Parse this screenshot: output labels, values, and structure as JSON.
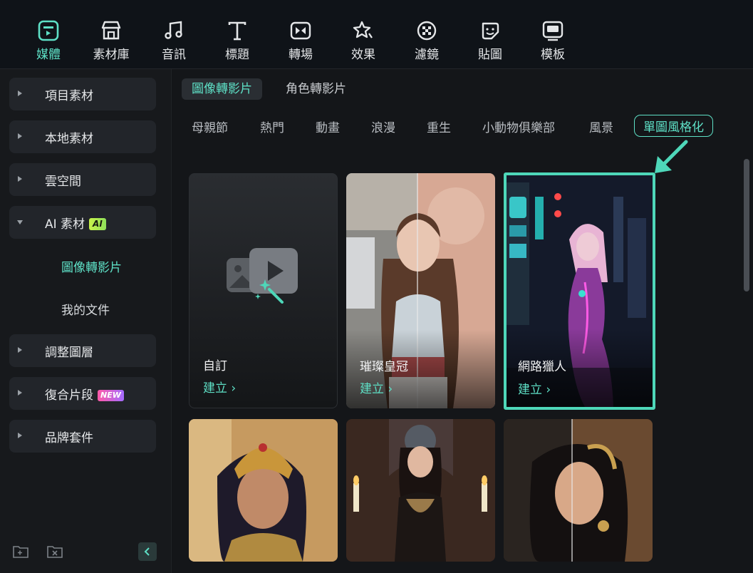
{
  "toolbar": {
    "items": [
      {
        "label": "媒體",
        "icon": "media-icon"
      },
      {
        "label": "素材庫",
        "icon": "store-icon"
      },
      {
        "label": "音訊",
        "icon": "music-note-icon"
      },
      {
        "label": "標題",
        "icon": "text-t-icon"
      },
      {
        "label": "轉場",
        "icon": "transition-icon"
      },
      {
        "label": "效果",
        "icon": "effects-star-icon"
      },
      {
        "label": "濾鏡",
        "icon": "filter-icon"
      },
      {
        "label": "貼圖",
        "icon": "sticker-icon"
      },
      {
        "label": "模板",
        "icon": "template-icon"
      }
    ],
    "active_index": 0
  },
  "sidebar": {
    "items": [
      {
        "label": "項目素材"
      },
      {
        "label": "本地素材"
      },
      {
        "label": "雲空間"
      },
      {
        "label": "AI 素材",
        "badge": "AI"
      },
      {
        "label": "調整圖層"
      },
      {
        "label": "復合片段",
        "badge": "NEW"
      },
      {
        "label": "品牌套件"
      }
    ],
    "sub_items": [
      {
        "label": "圖像轉影片"
      },
      {
        "label": "我的文件"
      }
    ]
  },
  "main": {
    "tabs": [
      {
        "label": "圖像轉影片"
      },
      {
        "label": "角色轉影片"
      }
    ],
    "categories": [
      {
        "label": "母親節"
      },
      {
        "label": "熱門"
      },
      {
        "label": "動畫"
      },
      {
        "label": "浪漫"
      },
      {
        "label": "重生"
      },
      {
        "label": "小動物俱樂部"
      },
      {
        "label": "風景"
      },
      {
        "label": "單圖風格化"
      }
    ],
    "cards": [
      {
        "title": "自訂",
        "action": "建立 ›"
      },
      {
        "title": "璀璨皇冠",
        "action": "建立 ›"
      },
      {
        "title": "網路獵人",
        "action": "建立 ›"
      }
    ]
  },
  "colors": {
    "accent": "#5ee0c6",
    "highlight": "#4ed7b9",
    "sidebar_item_bg": "#22252a",
    "background": "#141619"
  }
}
